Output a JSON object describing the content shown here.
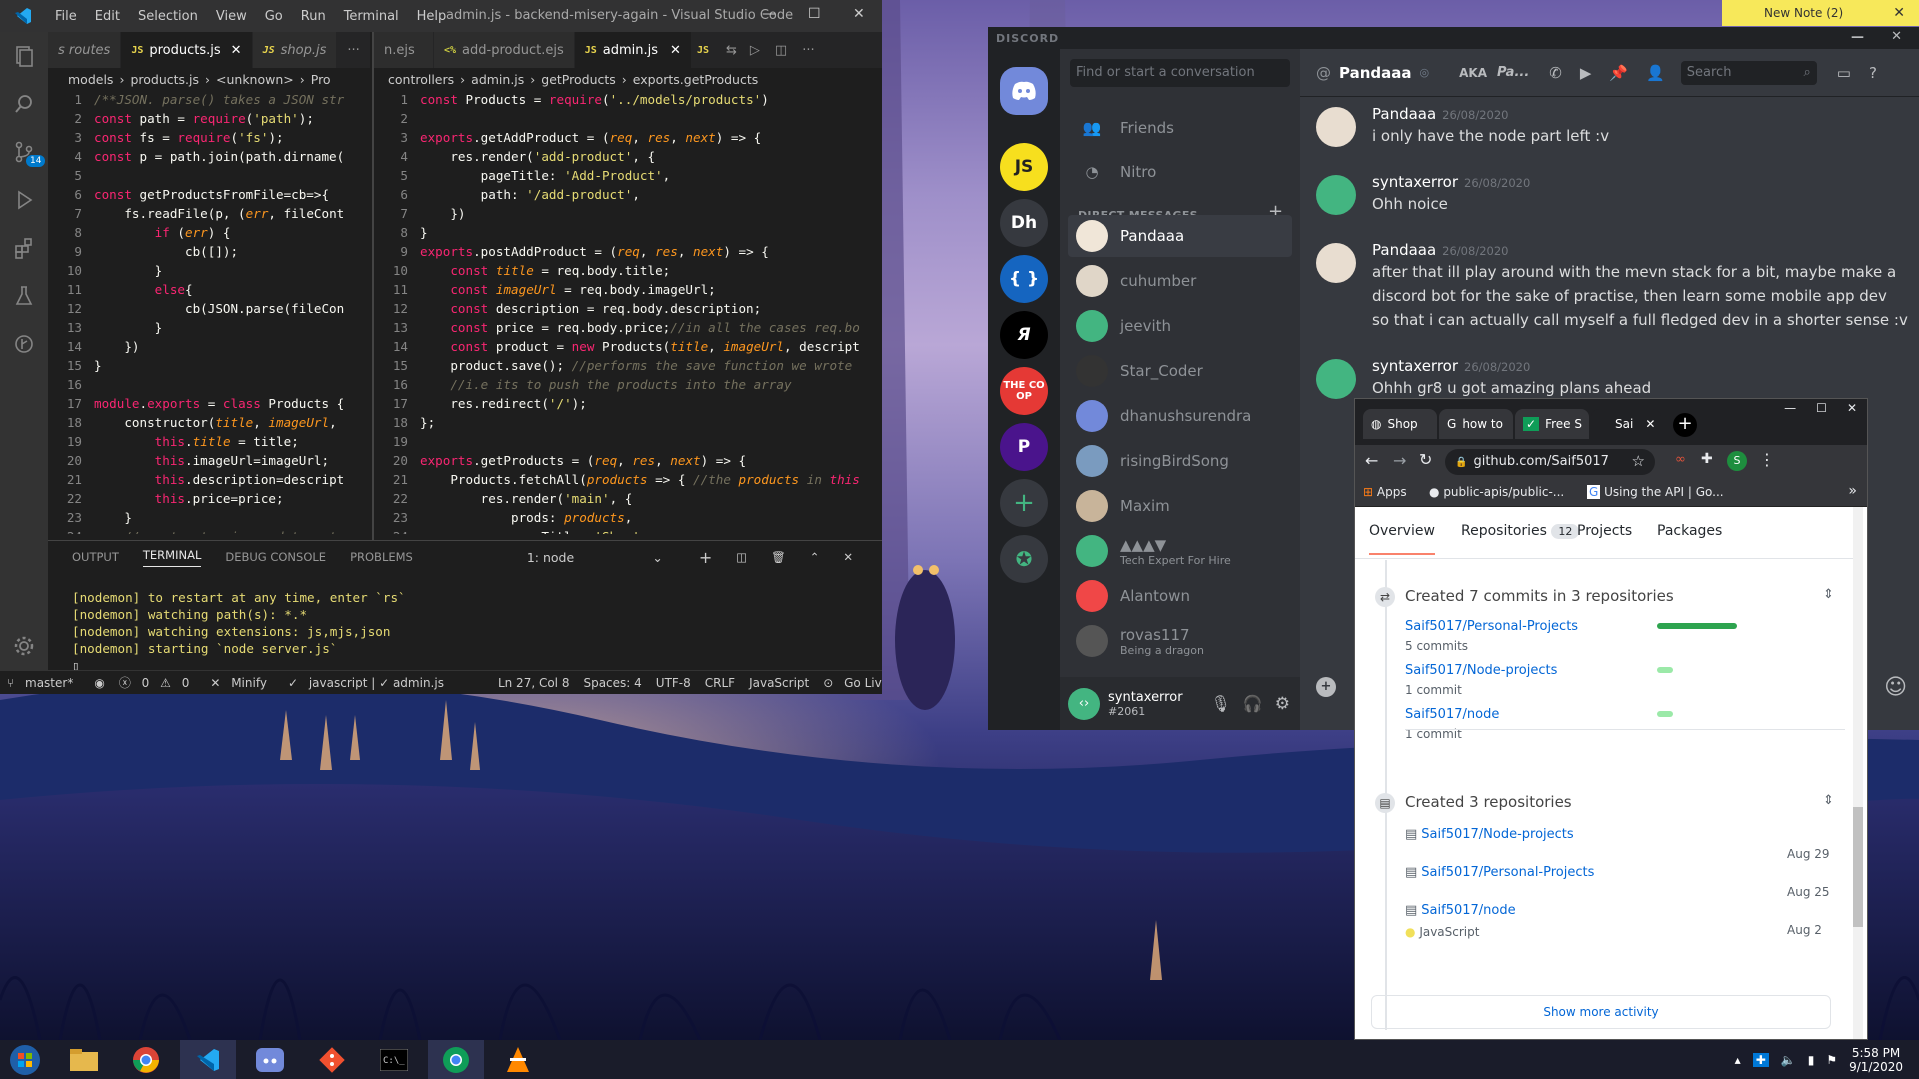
{
  "colors": {
    "vs_bg": "#1e1e1e",
    "accent": "#007acc",
    "discord_bg": "#36393f",
    "github_green": "#2ea44f",
    "note_yellow": "#f7e85a"
  },
  "vscode": {
    "menu": [
      "File",
      "Edit",
      "Selection",
      "View",
      "Go",
      "Run",
      "Terminal",
      "Help"
    ],
    "window_title": "admin.js - backend-misery-again - Visual Studio Code",
    "badge": "14",
    "left_tabs": [
      "s routes",
      "products.js",
      "shop.js"
    ],
    "right_tabs": [
      "n.ejs",
      "add-product.ejs",
      "admin.js"
    ],
    "left_crumb": [
      "models",
      "›",
      "products.js",
      "›",
      "<unknown>",
      "›",
      "Pro"
    ],
    "right_crumb": [
      "controllers",
      "›",
      "admin.js",
      "›",
      "getProducts",
      "›",
      "exports.getProducts"
    ],
    "left_code": [
      "/**JSON. parse() takes a JSON str",
      "const path = require('path');",
      "const fs = require('fs');",
      "const p = path.join(path.dirname(",
      "",
      "const getProductsFromFile=cb=>{",
      "    fs.readFile(p, (err, fileCont",
      "        if (err) {",
      "            cb([]);",
      "        }",
      "        else{",
      "            cb(JSON.parse(fileCon",
      "        }",
      "    })",
      "}",
      "",
      "module.exports = class Products {",
      "    constructor(title, imageUrl,",
      "        this.title = title;",
      "        this.imageUrl=imageUrl;",
      "        this.description=descript",
      "        this.price=price;",
      "    }",
      "    //constructor is used to sets"
    ],
    "right_code": [
      "const Products = require('../models/products')",
      "",
      "exports.getAddProduct = (req, res, next) => {",
      "    res.render('add-product', {",
      "        pageTitle: 'Add-Product',",
      "        path: '/add-product',",
      "    })",
      "}",
      "exports.postAddProduct = (req, res, next) => {",
      "    const title = req.body.title;",
      "    const imageUrl = req.body.imageUrl;",
      "    const description = req.body.description;",
      "    const price = req.body.price;//in all the cases req.bo",
      "    const product = new Products(title, imageUrl, descript",
      "    product.save(); //performs the save function we wrote",
      "    //i.e its to push the products into the array",
      "    res.redirect('/');",
      "};",
      "",
      "exports.getProducts = (req, res, next) => {",
      "    Products.fetchAll(products => { //the products in this",
      "        res.render('main', {",
      "            prods: products,",
      "            pageTitle: 'Shop',"
    ],
    "panel_tabs": [
      "OUTPUT",
      "TERMINAL",
      "DEBUG CONSOLE",
      "PROBLEMS"
    ],
    "terminal_select": "1: node",
    "terminal": [
      "[nodemon] to restart at any time, enter `rs`",
      "[nodemon] watching path(s): *.*",
      "[nodemon] watching extensions: js,mjs,json",
      "[nodemon] starting `node server.js`"
    ],
    "status": {
      "branch": "master*",
      "errors": "0",
      "warnings": "0",
      "minify": "Minify",
      "lint": "javascript | ✓ admin.js",
      "pos": "Ln 27, Col 8",
      "spaces": "Spaces: 4",
      "enc": "UTF-8",
      "eol": "CRLF",
      "lang": "JavaScript",
      "live": "Go Live"
    }
  },
  "discord": {
    "brand": "DISCORD",
    "search_placeholder": "Find or start a conversation",
    "friends": "Friends",
    "nitro": "Nitro",
    "dm_header": "DIRECT MESSAGES",
    "guilds": [
      "JS",
      "Dh",
      "{ }",
      "Я",
      "THE CO OP",
      "P"
    ],
    "dms": [
      {
        "name": "Pandaaa",
        "sub": ""
      },
      {
        "name": "cuhumber",
        "sub": ""
      },
      {
        "name": "jeevith",
        "sub": ""
      },
      {
        "name": "Star_Coder",
        "sub": ""
      },
      {
        "name": "dhanushsurendra",
        "sub": ""
      },
      {
        "name": "risingBirdSong",
        "sub": ""
      },
      {
        "name": "Maxim",
        "sub": ""
      },
      {
        "name": "▲▲▲▼",
        "sub": "Tech Expert For Hire"
      },
      {
        "name": "Alantown",
        "sub": ""
      },
      {
        "name": "rovas117",
        "sub": "Being a dragon"
      }
    ],
    "user": {
      "name": "syntaxerror",
      "tag": "#2061"
    },
    "chat_user": "Pandaaa",
    "aka": "AKA",
    "aka_name": "Pa...",
    "chat_search": "Search",
    "messages": [
      {
        "author": "Pandaaa",
        "time": "26/08/2020",
        "lines": [
          "i only have the node part left :v"
        ]
      },
      {
        "author": "syntaxerror",
        "time": "26/08/2020",
        "lines": [
          "Ohh noice"
        ]
      },
      {
        "author": "Pandaaa",
        "time": "26/08/2020",
        "lines": [
          "after that ill play around with the mevn stack for a bit, maybe make a",
          "discord bot for the sake of practise, then learn some mobile app dev",
          "so that i can actually call myself a full fledged dev in a shorter sense :v"
        ]
      },
      {
        "author": "syntaxerror",
        "time": "26/08/2020",
        "lines": [
          "Ohhh gr8 u got amazing plans ahead"
        ]
      }
    ]
  },
  "chrome": {
    "tabs": [
      "Shop",
      "how to",
      "Free S",
      "Sai"
    ],
    "url": "github.com/Saif5017",
    "profile": "S",
    "bookmarks": [
      "Apps",
      "public-apis/public-...",
      "Using the API | Go..."
    ],
    "gh_tabs": {
      "overview": "Overview",
      "repos": "Repositories",
      "repos_count": "12",
      "projects": "Projects",
      "packages": "Packages"
    },
    "commits_title": "Created 7 commits in 3 repositories",
    "commits": [
      {
        "repo": "Saif5017/Personal-Projects",
        "count": "5 commits",
        "frac": 1.0
      },
      {
        "repo": "Saif5017/Node-projects",
        "count": "1 commit",
        "frac": 0.2
      },
      {
        "repo": "Saif5017/node",
        "count": "1 commit",
        "frac": 0.2
      }
    ],
    "repos_title": "Created 3 repositories",
    "repos": [
      {
        "name": "Saif5017/Node-projects",
        "date": "Aug 29"
      },
      {
        "name": "Saif5017/Personal-Projects",
        "date": "Aug 25"
      },
      {
        "name": "Saif5017/node",
        "date": "Aug 2",
        "lang": "JavaScript"
      }
    ],
    "show_more": "Show more activity"
  },
  "note": {
    "title": "New Note (2)"
  },
  "taskbar": {
    "time": "5:58 PM",
    "date": "9/1/2020"
  }
}
